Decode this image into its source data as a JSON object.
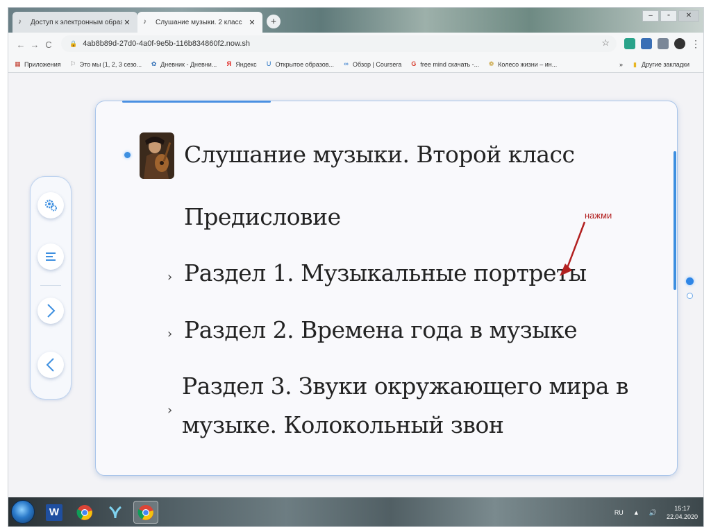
{
  "browser": {
    "tabs": [
      {
        "title": "Доступ к электронным образо..",
        "active": false
      },
      {
        "title": "Слушание музыки. 2 класс",
        "active": true
      }
    ],
    "new_tab_glyph": "+",
    "window_controls": [
      "–",
      "▫",
      "✕"
    ],
    "url": "4ab8b89d-27d0-4a0f-9e5b-116b834860f2.now.sh",
    "bookmarks": [
      {
        "label": "Приложения",
        "icon": "apps-grid-icon"
      },
      {
        "label": "Это мы (1, 2, 3 сезо...",
        "icon": "ribbon-icon"
      },
      {
        "label": "Дневник - Дневни...",
        "icon": "dnevnik-icon"
      },
      {
        "label": "Яндекс",
        "icon": "yandex-icon"
      },
      {
        "label": "Открытое образов...",
        "icon": "openedu-icon"
      },
      {
        "label": "Обзор | Coursera",
        "icon": "coursera-icon"
      },
      {
        "label": "free mind скачать -...",
        "icon": "google-icon"
      },
      {
        "label": "Колесо жизни – ин...",
        "icon": "wheel-icon"
      }
    ],
    "bookmarks_overflow": "»",
    "other_bookmarks": "Другие закладки"
  },
  "toc": {
    "title": "Слушание музыки. Второй класс",
    "preface": "Предисловие",
    "section1": "Раздел 1. Музыкальные портреты",
    "section2": "Раздел 2. Времена года в музыке",
    "section3_line1": "Раздел 3. Звуки окружающего мира в",
    "section3_line2": "музыке. Колокольный звон",
    "chevron": "›"
  },
  "annotation": {
    "text": "нажми",
    "color": "#b22020"
  },
  "taskbar": {
    "apps": [
      "windows-start",
      "word",
      "chrome",
      "yandex-browser",
      "chrome-active"
    ],
    "language": "RU",
    "tray_arrow": "▲",
    "time": "15:17",
    "date": "22.04.2020"
  },
  "colors": {
    "accent": "#3d8fe0",
    "panel_border": "#a9c5ea"
  }
}
